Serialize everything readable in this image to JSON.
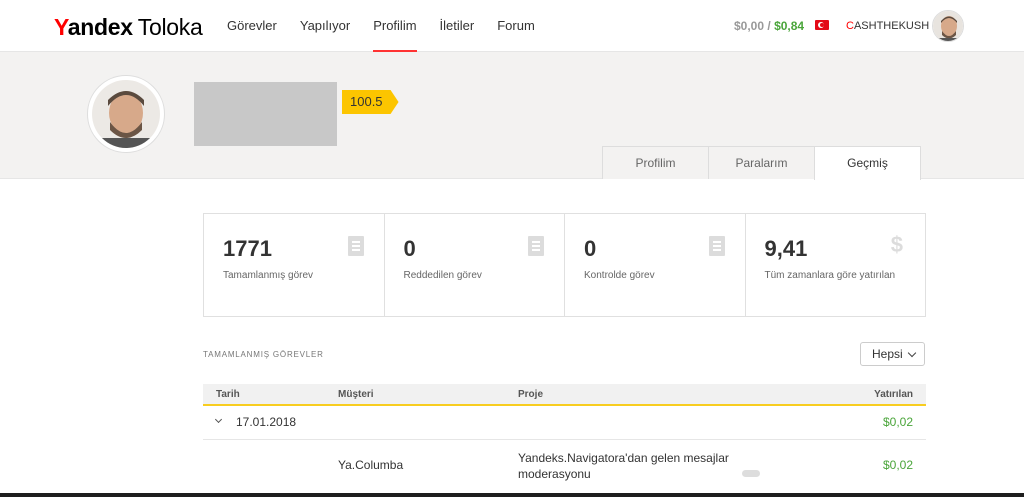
{
  "header": {
    "logo_brand": "Yandex",
    "logo_product": "Toloka",
    "nav": [
      {
        "label": "Görevler"
      },
      {
        "label": "Yapılıyor"
      },
      {
        "label": "Profilim"
      },
      {
        "label": "İletiler"
      },
      {
        "label": "Forum"
      }
    ],
    "active_nav": "Profilim",
    "balance_available": "$0,00",
    "balance_separator": "/",
    "balance_total": "$0,84",
    "username_first": "C",
    "username_rest": "ASHTHEKUSH"
  },
  "profile": {
    "rating": "100.5",
    "tabs": [
      {
        "label": "Profilim"
      },
      {
        "label": "Paralarım"
      },
      {
        "label": "Geçmiş"
      }
    ],
    "active_tab": "Geçmiş"
  },
  "stats": [
    {
      "value": "1771",
      "label": "Tamamlanmış görev",
      "icon": "document-icon"
    },
    {
      "value": "0",
      "label": "Reddedilen görev",
      "icon": "document-icon"
    },
    {
      "value": "0",
      "label": "Kontrolde görev",
      "icon": "document-icon"
    },
    {
      "value": "9,41",
      "label": "Tüm zamanlara göre yatırılan",
      "icon": "dollar-icon"
    }
  ],
  "completed": {
    "title": "TAMAMLANMIŞ GÖREVLER",
    "filter_value": "Hepsi",
    "columns": {
      "date": "Tarih",
      "client": "Müşteri",
      "project": "Proje",
      "paid": "Yatırılan"
    },
    "groups": [
      {
        "date": "17.01.2018",
        "amount": "$0,02",
        "rows": [
          {
            "client": "Ya.Columba",
            "project": "Yandeks.Navigatora'dan gelen mesajlar moderasyonu",
            "amount": "$0,02"
          }
        ]
      }
    ]
  },
  "colors": {
    "accent_red": "#ff3333",
    "money_green": "#4aa53a",
    "badge_yellow": "#fcc500"
  }
}
